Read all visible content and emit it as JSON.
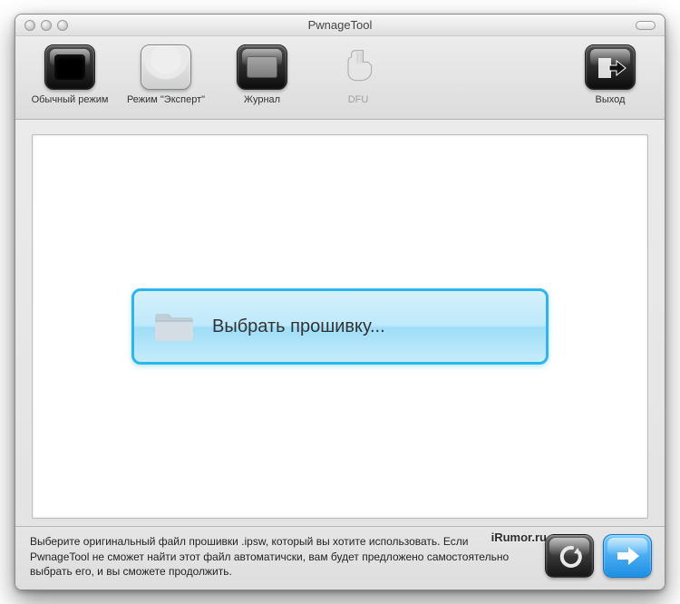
{
  "window": {
    "title": "PwnageTool"
  },
  "toolbar": {
    "items": [
      {
        "id": "mode-normal",
        "label": "Обычный режим",
        "icon": "normal-mode-icon"
      },
      {
        "id": "mode-expert",
        "label": "Режим \"Эксперт\"",
        "icon": "einstein-icon",
        "selected": true
      },
      {
        "id": "log",
        "label": "Журнал",
        "icon": "log-icon"
      },
      {
        "id": "dfu",
        "label": "DFU",
        "icon": "dfu-hand-icon",
        "disabled": true
      }
    ],
    "exit": {
      "label": "Выход",
      "icon": "exit-icon"
    }
  },
  "main": {
    "select_firmware_label": "Выбрать прошивку..."
  },
  "footer": {
    "hint": "Выберите оригинальный файл прошивки .ipsw, который вы хотите использовать. Если PwnageTool не сможет найти этот файл автоматичски, вам будет предложено самостоятельно выбрать его, и вы сможете продолжить.",
    "watermark": "iRumor.ru"
  }
}
